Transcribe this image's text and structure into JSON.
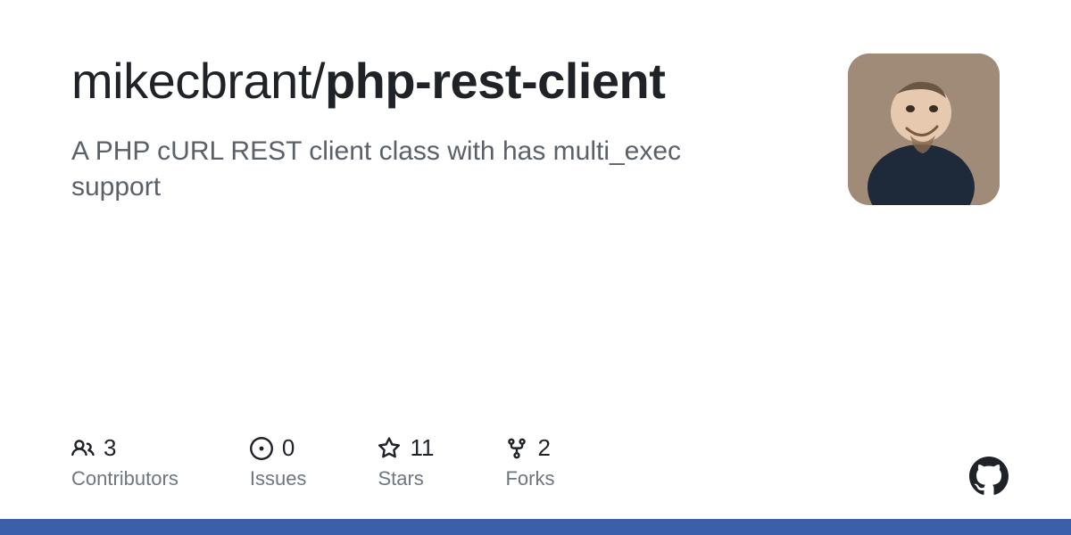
{
  "repo": {
    "owner": "mikecbrant",
    "name": "php-rest-client",
    "description": "A PHP cURL REST client class with has multi_exec support"
  },
  "stats": {
    "contributors": {
      "count": "3",
      "label": "Contributors"
    },
    "issues": {
      "count": "0",
      "label": "Issues"
    },
    "stars": {
      "count": "11",
      "label": "Stars"
    },
    "forks": {
      "count": "2",
      "label": "Forks"
    }
  },
  "colors": {
    "accent": "#3b5fab"
  }
}
